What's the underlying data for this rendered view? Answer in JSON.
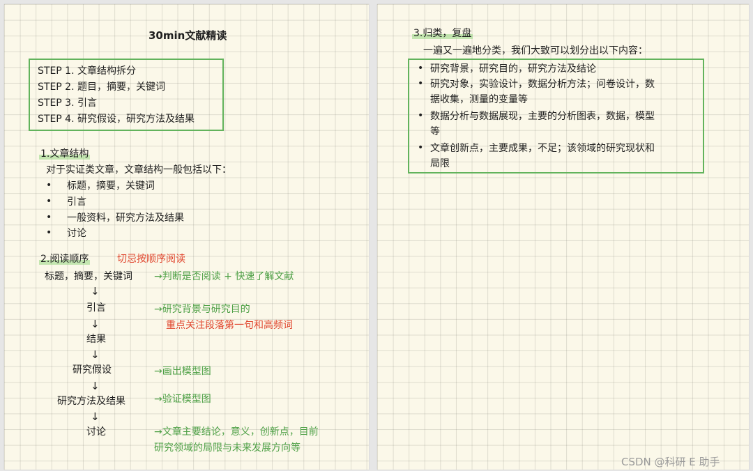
{
  "left": {
    "title": "30min文献精读",
    "steps": [
      "STEP 1. 文章结构拆分",
      "STEP 2. 题目，摘要，关键词",
      "STEP 3. 引言",
      "STEP 4. 研究假设，研究方法及结果"
    ],
    "section1": {
      "heading": "1.文章结构",
      "intro": "对于实证类文章，文章结构一般包括以下：",
      "items": [
        "标题，摘要，关键词",
        "引言",
        "一般资料，研究方法及结果",
        "讨论"
      ]
    },
    "section2": {
      "heading": "2.阅读顺序",
      "note": "切忌按顺序阅读",
      "flow": [
        {
          "label": "标题，摘要，关键词",
          "comment": [
            "→判断是否阅读 + 快速了解文献"
          ]
        },
        {
          "label": "引言",
          "comment": [
            "→研究背景与研究目的"
          ],
          "emphasis": "重点关注段落第一句和高频词"
        },
        {
          "label": "结果",
          "comment": []
        },
        {
          "label": "研究假设",
          "comment": [
            "→画出模型图"
          ]
        },
        {
          "label": "研究方法及结果",
          "comment": [
            "→验证模型图"
          ]
        },
        {
          "label": "讨论",
          "comment": [
            "→文章主要结论，意义，创新点，目前",
            "研究领域的局限与未来发展方向等"
          ]
        }
      ],
      "arrow": "↓"
    }
  },
  "right": {
    "heading": "3.归类，复盘",
    "intro": "一遍又一遍地分类，我们大致可以划分出以下内容：",
    "items": [
      [
        "研究背景，研究目的，研究方法及结论"
      ],
      [
        "研究对象，实验设计，数据分析方法；问卷设计，数",
        "据收集，测量的变量等"
      ],
      [
        "数据分析与数据展现，主要的分析图表，数据，模型",
        "等"
      ],
      [
        "文章创新点，主要成果，不足；该领域的研究现状和",
        "局限"
      ]
    ]
  },
  "watermark": "CSDN @科研 E 助手",
  "colors": {
    "box_border": "#62b35c",
    "comment_green": "#4ea046",
    "note_red": "#e0452d",
    "highlight": "#96d782"
  }
}
